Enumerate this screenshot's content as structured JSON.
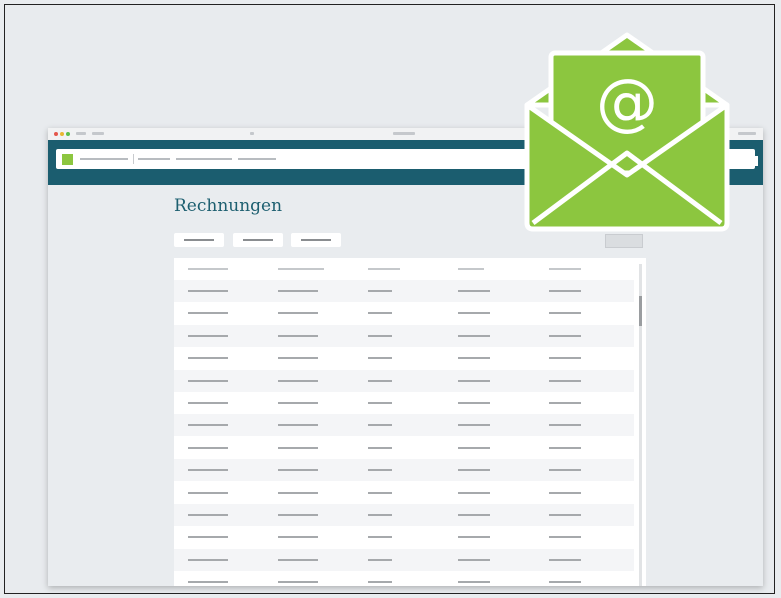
{
  "page": {
    "title": "Rechnungen"
  },
  "icons": {
    "envelope": "email-envelope-icon",
    "at_symbol": "@"
  },
  "colors": {
    "header": "#1b5d6f",
    "accent_green": "#8cc63f",
    "title_color": "#1d5f70"
  },
  "table": {
    "row_count": 14
  }
}
